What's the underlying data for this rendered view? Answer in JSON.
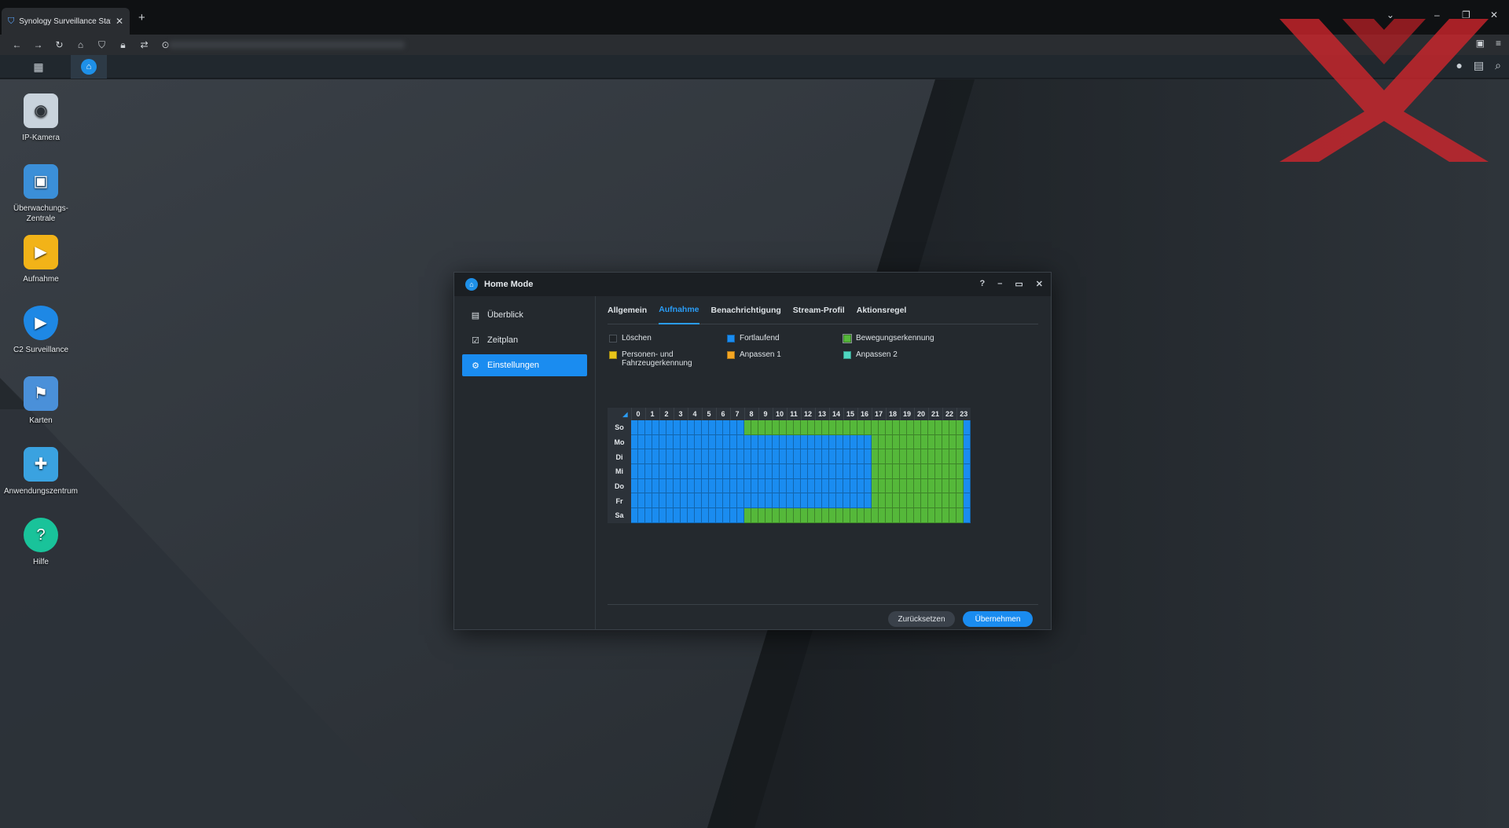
{
  "browser": {
    "tab_title": "Synology Surveillance Station",
    "tab_close": "✕",
    "new_tab": "+"
  },
  "desktop_icons": [
    {
      "label": "IP-Kamera",
      "icon": "camera-icon",
      "color": "#c9d3dc"
    },
    {
      "label": "Überwachungs-Zentrale",
      "icon": "monitor-icon",
      "color": "#3b8fd8"
    },
    {
      "label": "Aufnahme",
      "icon": "recording-icon",
      "color": "#f2b318"
    },
    {
      "label": "C2 Surveillance",
      "icon": "shield-play-icon",
      "color": "#1e88e5"
    },
    {
      "label": "Karten",
      "icon": "map-icon",
      "color": "#4a90d9"
    },
    {
      "label": "Anwendungszentrum",
      "icon": "puzzle-icon",
      "color": "#3aa2e0"
    },
    {
      "label": "Hilfe",
      "icon": "help-icon",
      "color": "#19c39a"
    }
  ],
  "window": {
    "title": "Home Mode",
    "controls": {
      "help": "?",
      "minimize": "–",
      "maximize": "▭",
      "close": "✕"
    },
    "sidebar": [
      {
        "label": "Überblick",
        "icon": "overview-icon",
        "active": false
      },
      {
        "label": "Zeitplan",
        "icon": "calendar-icon",
        "active": false
      },
      {
        "label": "Einstellungen",
        "icon": "gear-icon",
        "active": true
      }
    ],
    "tabs": [
      "Allgemein",
      "Aufnahme",
      "Benachrichtigung",
      "Stream-Profil",
      "Aktionsregel"
    ],
    "active_tab": "Aufnahme",
    "legend": [
      {
        "label": "Löschen",
        "color": "#1f2327"
      },
      {
        "label": "Fortlaufend",
        "color": "#1a8cf0"
      },
      {
        "label": "Bewegungserkennung",
        "color": "#55b83a"
      },
      {
        "label": "Personen- und Fahrzeugerkennung",
        "color": "#e8c51a"
      },
      {
        "label": "Anpassen 1",
        "color": "#f5a623"
      },
      {
        "label": "Anpassen 2",
        "color": "#4fd6c0"
      }
    ],
    "schedule": {
      "hours": [
        "0",
        "1",
        "2",
        "3",
        "4",
        "5",
        "6",
        "7",
        "8",
        "9",
        "10",
        "11",
        "12",
        "13",
        "14",
        "15",
        "16",
        "17",
        "18",
        "19",
        "20",
        "21",
        "22",
        "23"
      ],
      "days": [
        "So",
        "Mo",
        "Di",
        "Mi",
        "Do",
        "Fr",
        "Sa"
      ],
      "green_ranges_half_hours": [
        [
          16,
          47
        ],
        [
          34,
          47
        ],
        [
          34,
          47
        ],
        [
          34,
          47
        ],
        [
          34,
          47
        ],
        [
          34,
          47
        ],
        [
          16,
          47
        ]
      ],
      "corner_mark": "◢"
    },
    "buttons": {
      "reset": "Zurücksetzen",
      "apply": "Übernehmen"
    }
  }
}
